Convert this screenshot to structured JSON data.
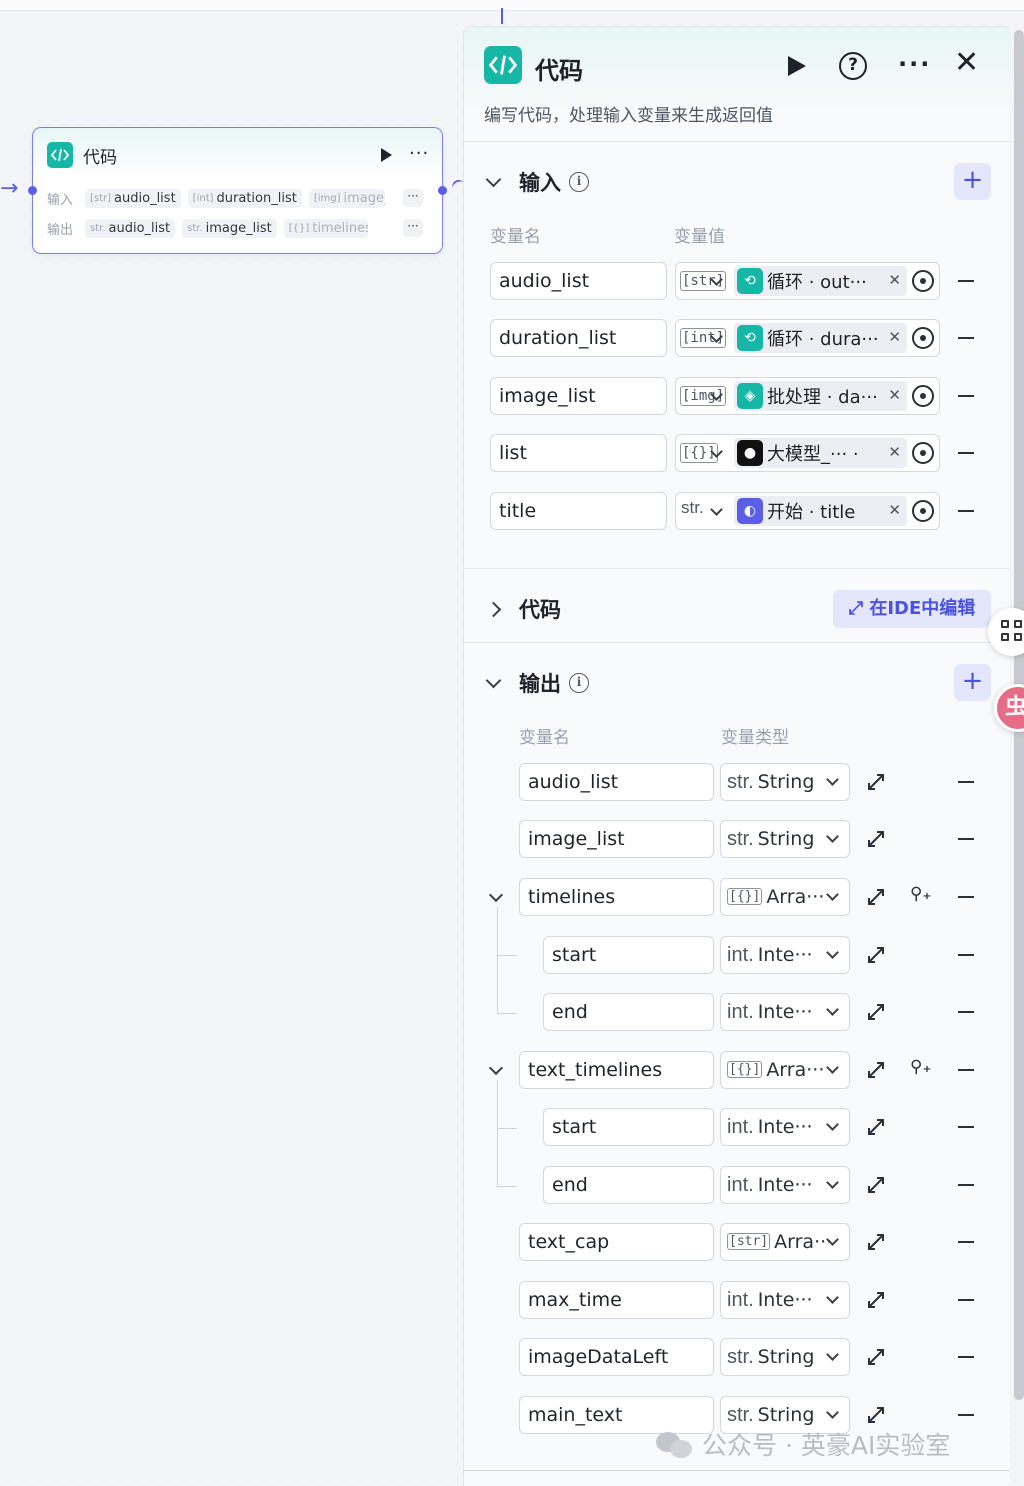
{
  "node": {
    "title": "代码",
    "input_label": "输入",
    "output_label": "输出",
    "inputs": [
      {
        "type": "[str]",
        "name": "audio_list"
      },
      {
        "type": "[int]",
        "name": "duration_list"
      },
      {
        "type": "[img]",
        "name": "image_l"
      }
    ],
    "outputs": [
      {
        "type": "str.",
        "name": "audio_list"
      },
      {
        "type": "str.",
        "name": "image_list"
      },
      {
        "type": "[{}]",
        "name": "timelines"
      }
    ],
    "more_chips": "···"
  },
  "panel": {
    "title": "代码",
    "description": "编写代码，处理输入变量来生成返回值",
    "input_section": {
      "title": "输入",
      "col_name": "变量名",
      "col_value": "变量值",
      "rows": [
        {
          "name": "audio_list",
          "type": "[str]",
          "source": "循环 · out···",
          "icon_color": "#16b7a6",
          "icon": "loop-icon"
        },
        {
          "name": "duration_list",
          "type": "[int]",
          "source": "循环 · dura···",
          "icon_color": "#16b7a6",
          "icon": "loop-icon"
        },
        {
          "name": "image_list",
          "type": "[img]",
          "source": "批处理 · da···",
          "icon_color": "#16b7a6",
          "icon": "batch-icon"
        },
        {
          "name": "list",
          "type": "[{}]",
          "source": "大模型_··· ·",
          "icon_color": "#111111",
          "icon": "llm-icon"
        },
        {
          "name": "title",
          "type": "str.",
          "source": "开始 · title",
          "icon_color": "#5b5fe8",
          "icon": "start-icon"
        }
      ]
    },
    "code_section": {
      "title": "代码",
      "ide_button": "在IDE中编辑"
    },
    "output_section": {
      "title": "输出",
      "col_name": "变量名",
      "col_type": "变量类型",
      "rows": [
        {
          "name": "audio_list",
          "type_tag": "str.",
          "type": "String"
        },
        {
          "name": "image_list",
          "type_tag": "str.",
          "type": "String"
        },
        {
          "name": "timelines",
          "type_tag": "[{}]",
          "type": "Arra···"
        },
        {
          "name": "start",
          "type_tag": "int.",
          "type": "Inte···"
        },
        {
          "name": "end",
          "type_tag": "int.",
          "type": "Inte···"
        },
        {
          "name": "text_timelines",
          "type_tag": "[{}]",
          "type": "Arra···"
        },
        {
          "name": "start",
          "type_tag": "int.",
          "type": "Inte···"
        },
        {
          "name": "end",
          "type_tag": "int.",
          "type": "Inte···"
        },
        {
          "name": "text_cap",
          "type_tag": "[str]",
          "type": "Arra···"
        },
        {
          "name": "max_time",
          "type_tag": "int.",
          "type": "Inte···"
        },
        {
          "name": "imageDataLeft",
          "type_tag": "str.",
          "type": "String"
        },
        {
          "name": "main_text",
          "type_tag": "str.",
          "type": "String"
        }
      ]
    }
  },
  "watermark": "公众号 · 英豪AI实验室",
  "float_badge": "虫",
  "colors": {
    "accent": "#5b5fe8",
    "code_icon": "#16b7a6"
  }
}
